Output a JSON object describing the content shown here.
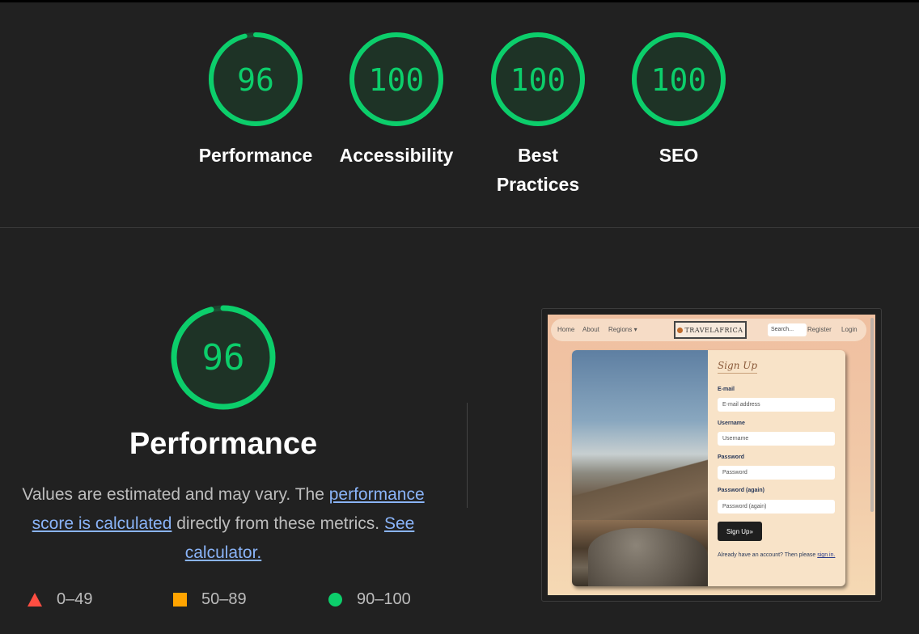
{
  "colors": {
    "pass": "#0cce6b",
    "average": "#ffa400",
    "fail": "#ff4e42",
    "background": "#212121",
    "link": "#8ab4f8"
  },
  "scores": [
    {
      "label": "Performance",
      "score": 96
    },
    {
      "label": "Accessibility",
      "score": 100
    },
    {
      "label": "Best Practices",
      "score": 100
    },
    {
      "label": "SEO",
      "score": 100
    }
  ],
  "performance": {
    "score": 96,
    "title": "Performance",
    "desc_prefix": "Values are estimated and may vary. The ",
    "desc_link1": "performance score is calculated",
    "desc_middle": " directly from these metrics. ",
    "desc_link2": "See calculator."
  },
  "legend": [
    {
      "shape": "triangle",
      "range": "0–49"
    },
    {
      "shape": "square",
      "range": "50–89"
    },
    {
      "shape": "circle",
      "range": "90–100"
    }
  ],
  "screenshot": {
    "nav": {
      "home": "Home",
      "about": "About",
      "regions": "Regions ▾",
      "logo": "TRAVELAFRICA",
      "search_placeholder": "Search...",
      "register": "Register",
      "login": "Login"
    },
    "form": {
      "title": "Sign Up",
      "email_label": "E-mail",
      "email_placeholder": "E-mail address",
      "username_label": "Username",
      "username_placeholder": "Username",
      "password_label": "Password",
      "password_placeholder": "Password",
      "password2_label": "Password (again)",
      "password2_placeholder": "Password (again)",
      "button": "Sign Up»",
      "note": "Already have an account? Then please ",
      "note_link": "sign in."
    }
  }
}
